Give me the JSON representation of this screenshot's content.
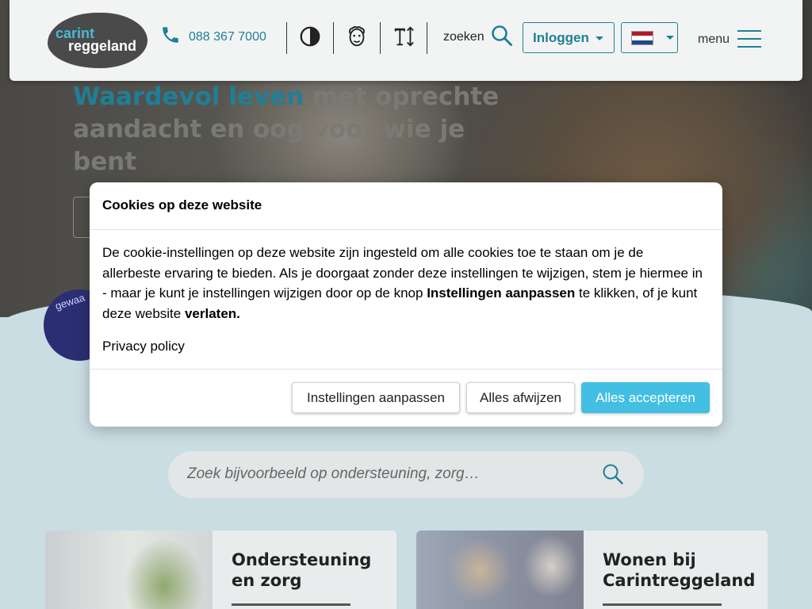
{
  "header": {
    "logo_line1": "carint",
    "logo_line2": "reggeland",
    "phone": "088 367 7000",
    "search_label": "zoeken",
    "login_label": "Inloggen",
    "menu_label": "menu",
    "language": "Nederlands"
  },
  "hero": {
    "title_accent": "Waardevol leven",
    "title_rest": " met oprechte aandacht en oog voor wie je bent",
    "badge_text": "gewaa"
  },
  "cookie_modal": {
    "title": "Cookies op deze website",
    "body_part1": "De cookie-instellingen op deze website zijn ingesteld om alle cookies toe te staan om je de allerbeste ervaring te bieden. Als je doorgaat zonder deze instellingen te wijzigen, stem je hiermee in - maar je kunt je instellingen wijzigen door op de knop ",
    "body_bold1": "Instellingen aanpassen",
    "body_part2": " te klikken, of je kunt deze website ",
    "body_bold2": "verlaten.",
    "privacy_link": "Privacy policy",
    "btn_settings": "Instellingen aanpassen",
    "btn_reject": "Alles afwijzen",
    "btn_accept": "Alles accepteren"
  },
  "search": {
    "placeholder": "Zoek bijvoorbeeld op ondersteuning, zorg…"
  },
  "cards": [
    {
      "title": "Ondersteuning en zorg"
    },
    {
      "title": "Wonen bij Carintreggeland"
    }
  ],
  "colors": {
    "brand_teal": "#1f7f97",
    "accept_blue": "#42bfe2",
    "flag": [
      "#ae1c28",
      "#ffffff",
      "#21468b"
    ]
  },
  "icons": {
    "phone": "phone-icon",
    "contrast": "contrast-icon",
    "read_aloud": "read-aloud-icon",
    "text_size": "text-size-icon",
    "search": "search-icon",
    "menu": "hamburger-menu-icon"
  }
}
